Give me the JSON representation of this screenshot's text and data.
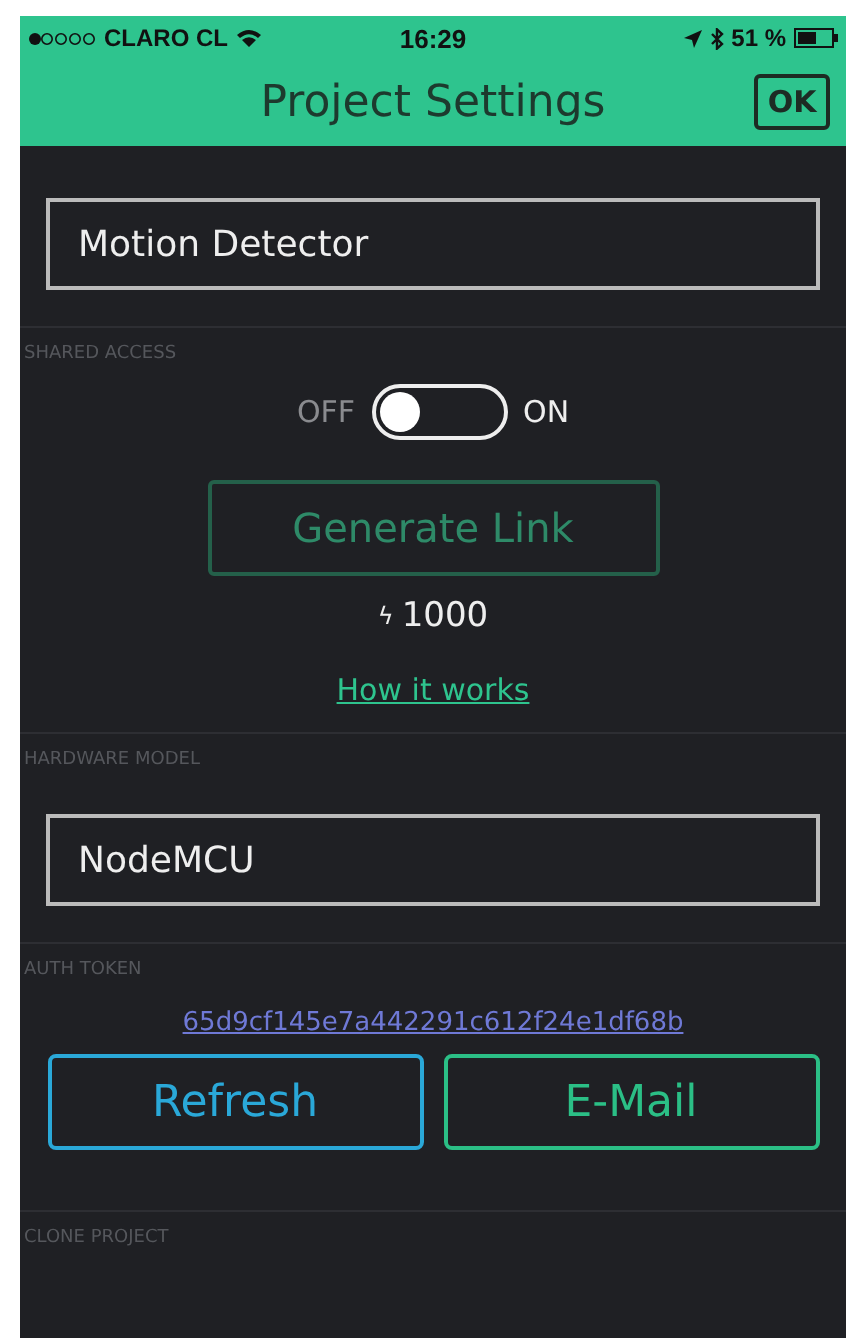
{
  "status_bar": {
    "carrier": "CLARO CL",
    "time": "16:29",
    "battery": "51 %"
  },
  "header": {
    "title": "Project Settings",
    "ok_button": "OK"
  },
  "project_name": {
    "value": "Motion Detector"
  },
  "shared_access": {
    "label": "SHARED ACCESS",
    "off_label": "OFF",
    "on_label": "ON",
    "on": false,
    "generate_button": "Generate Link",
    "energy_icon": "ϟ",
    "energy": "1000",
    "help_link": "How it works"
  },
  "hardware_model": {
    "label": "HARDWARE MODEL",
    "value": "NodeMCU"
  },
  "auth_token": {
    "label": "AUTH TOKEN",
    "token": "65d9cf145e7a442291c612f24e1df68b",
    "buttons": [
      {
        "label": "Refresh",
        "color": "#2aa8d8"
      },
      {
        "label": "E-Mail",
        "color": "#2bbf86"
      }
    ]
  },
  "clone_project": {
    "label": "CLONE PROJECT"
  }
}
